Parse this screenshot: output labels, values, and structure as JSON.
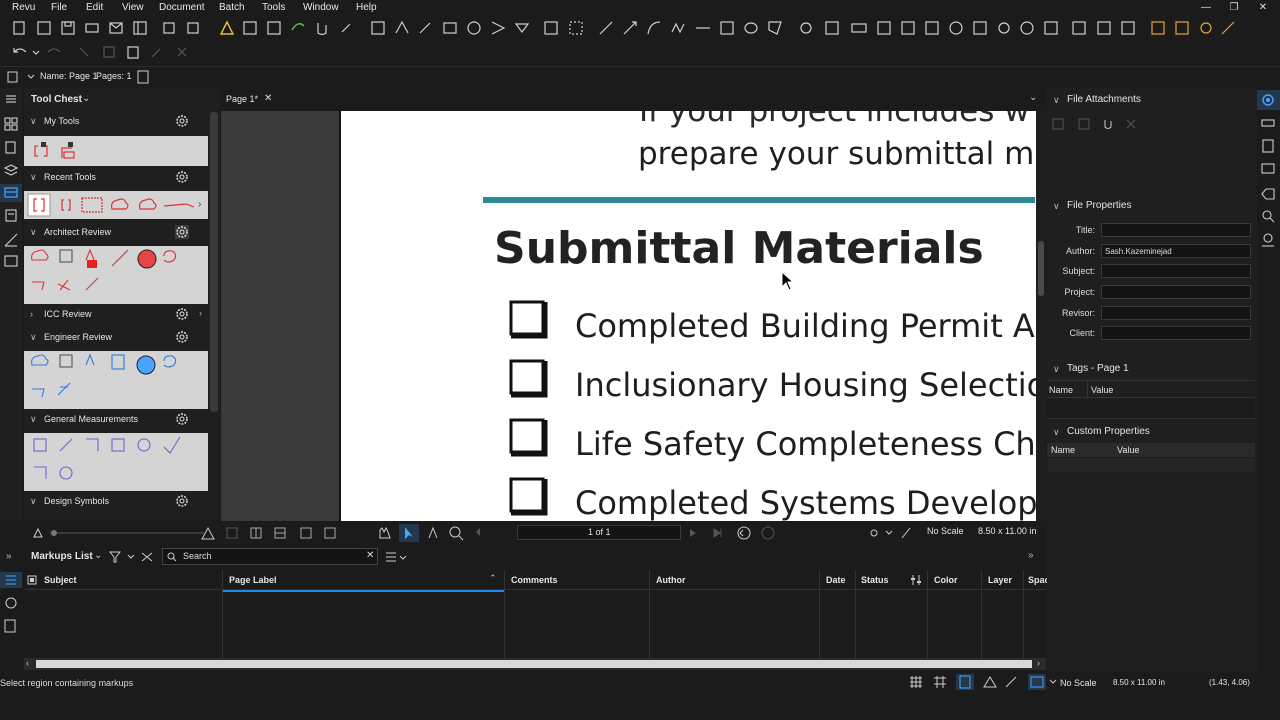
{
  "menu": {
    "items": [
      "Revu",
      "File",
      "Edit",
      "View",
      "Document",
      "Batch",
      "Tools",
      "Window",
      "Help"
    ]
  },
  "window_controls": [
    "minimize-icon",
    "restore-icon",
    "close-icon"
  ],
  "properties_bar": {
    "name_label": "Name: Page 1",
    "pages_label": "Pages: 1"
  },
  "tool_chest": {
    "title": "Tool Chest",
    "sections": [
      {
        "label": "My Tools",
        "expanded": true
      },
      {
        "label": "Recent Tools",
        "expanded": true
      },
      {
        "label": "Architect Review",
        "expanded": true
      },
      {
        "label": "ICC Review",
        "expanded": false
      },
      {
        "label": "Engineer Review",
        "expanded": true
      },
      {
        "label": "General Measurements",
        "expanded": true
      },
      {
        "label": "Design Symbols",
        "expanded": true
      }
    ]
  },
  "document": {
    "tab_label": "Page 1*",
    "lines": {
      "top_partial": "If your project includes w",
      "top_second": "prepare your submittal m",
      "heading": "Submittal Materials",
      "items": [
        "Completed Building Permit A",
        "Inclusionary Housing Selectio",
        "Life Safety Completeness Che",
        "Completed Systems Develop"
      ]
    },
    "accent_color": "#2e8b93"
  },
  "doc_status": {
    "page_indicator": "1 of 1",
    "scale": "No Scale",
    "page_size": "8.50 x 11.00 in"
  },
  "markups": {
    "title": "Markups List",
    "search_placeholder": "Search",
    "columns": [
      "Subject",
      "Page Label",
      "Comments",
      "Author",
      "Date",
      "Status",
      "Color",
      "Layer",
      "Spac"
    ]
  },
  "right_panel": {
    "file_attachments": "File Attachments",
    "file_properties": "File Properties",
    "props": [
      {
        "label": "Title:",
        "value": ""
      },
      {
        "label": "Author:",
        "value": "Sash.Kazeminejad"
      },
      {
        "label": "Subject:",
        "value": ""
      },
      {
        "label": "Project:",
        "value": ""
      },
      {
        "label": "Revisor:",
        "value": ""
      },
      {
        "label": "Client:",
        "value": ""
      }
    ],
    "tags_title": "Tags - Page 1",
    "tags_cols": [
      "Name",
      "Value"
    ],
    "custom_title": "Custom Properties",
    "custom_cols": [
      "Name",
      "Value"
    ]
  },
  "status_bar": {
    "hint": "Select region containing markups",
    "scale": "No Scale",
    "page_size": "8.50 x 11.00 in",
    "coords": "(1.43, 4.06)"
  },
  "colors": {
    "bg": "#1b1b1b",
    "panel": "#1f1f1f",
    "accent_blue": "#1e88e5",
    "tool_bg": "#d4d4d4"
  }
}
